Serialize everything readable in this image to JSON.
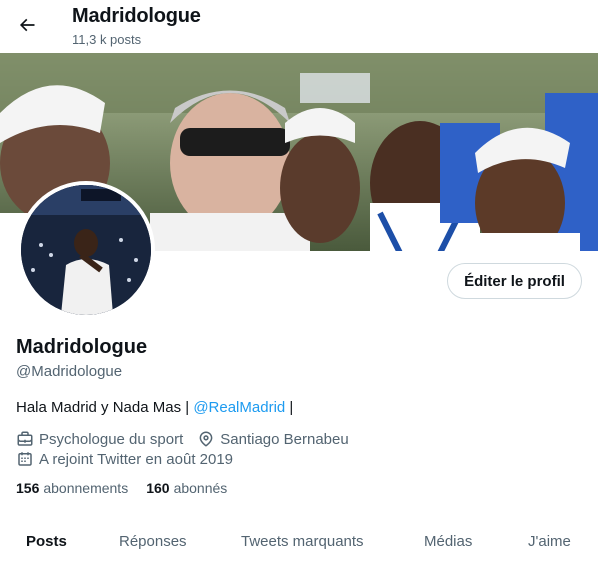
{
  "header": {
    "title": "Madridologue",
    "post_count": "11,3 k posts"
  },
  "profile": {
    "edit_label": "Éditer le profil",
    "name": "Madridologue",
    "handle": "@Madridologue",
    "bio_prefix": "Hala Madrid y Nada Mas | ",
    "bio_link": "@RealMadrid",
    "bio_suffix": " |",
    "job": "Psychologue du sport",
    "location": "Santiago Bernabeu",
    "joined": "A rejoint Twitter en août 2019",
    "following_count": "156",
    "following_label": "abonnements",
    "followers_count": "160",
    "followers_label": "abonnés"
  },
  "tabs": [
    {
      "label": "Posts"
    },
    {
      "label": "Réponses"
    },
    {
      "label": "Tweets marquants"
    },
    {
      "label": "Médias"
    },
    {
      "label": "J'aime"
    }
  ],
  "colors": {
    "accent": "#1d9bf0",
    "secondary_text": "#536471",
    "primary_text": "#0f1419"
  },
  "icons": [
    "back-arrow-icon",
    "briefcase-icon",
    "location-pin-icon",
    "calendar-icon"
  ]
}
